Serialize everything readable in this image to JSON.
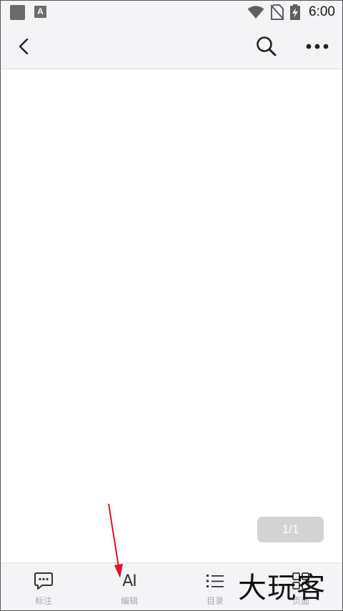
{
  "status_bar": {
    "time": "6:00",
    "icons": [
      "app-square-icon",
      "a-notification-icon",
      "wifi-icon",
      "no-sim-icon",
      "battery-charging-icon"
    ]
  },
  "app_bar": {
    "icons": {
      "back": "chevron-left-icon",
      "search": "search-icon",
      "more": "more-dots-icon"
    }
  },
  "page_indicator": "1/1",
  "toolbar": {
    "items": [
      {
        "label": "标注",
        "icon": "comment-icon"
      },
      {
        "label": "编辑",
        "icon": "text-edit-icon",
        "icon_text": "AI"
      },
      {
        "label": "目录",
        "icon": "list-icon"
      },
      {
        "label": "页面",
        "icon": "grid-icon"
      }
    ]
  },
  "annotation": {
    "color": "#e0141e"
  },
  "watermark": "大玩客",
  "colors": {
    "bar_bg": "#f4f4f6",
    "indicator_bg": "#d3d3d3",
    "label_gray": "#a8a8a8"
  }
}
